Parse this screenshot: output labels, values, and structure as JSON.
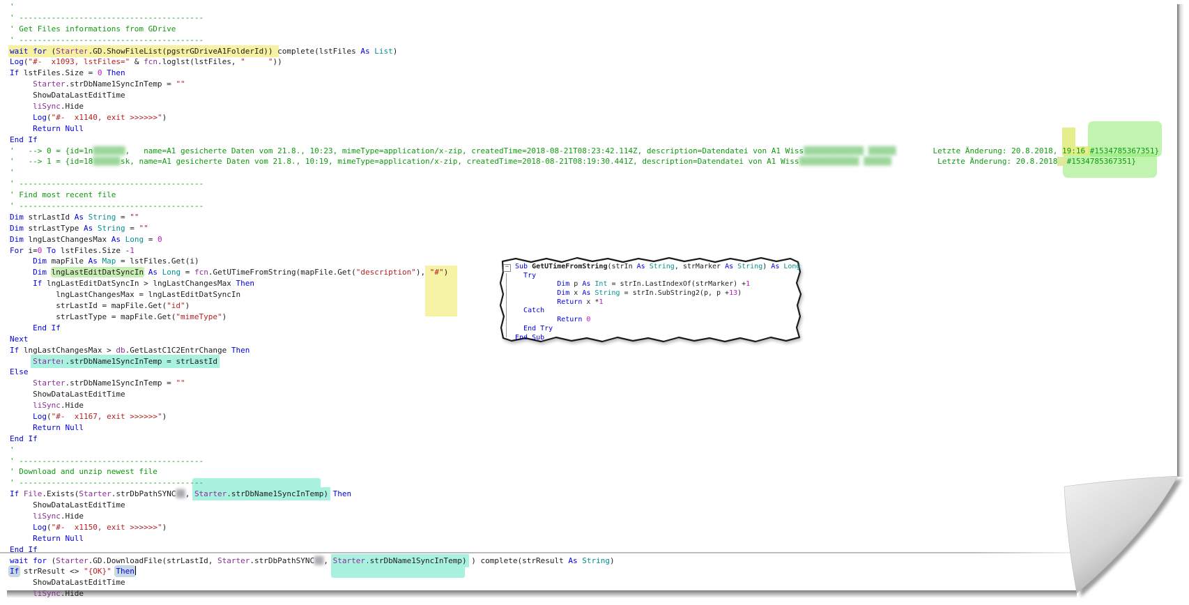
{
  "colors": {
    "keyword": "#0000E0",
    "comment": "#0D9B0D",
    "string": "#B22222",
    "number": "#C117C1",
    "module": "#8B2F97",
    "type": "#00918F",
    "plain": "#1C1C1C",
    "hl_yellow": "#F6F2A2",
    "hl_green_band": "rgba(140,235,110,0.55)",
    "hl_green_word": "#C8EEB4",
    "hl_cyan": "#A9F2E0",
    "hl_match": "#C8D8E3",
    "hl_strip": "rgba(224,235,120,0.85)"
  },
  "editor": {
    "lines": [
      {
        "segs": [
          [
            "c",
            "'"
          ]
        ]
      },
      {
        "segs": [
          [
            "c",
            "' ----------------------------------------"
          ]
        ]
      },
      {
        "segs": [
          [
            "c",
            "' Get Files informations from GDrive"
          ]
        ]
      },
      {
        "segs": [
          [
            "c",
            "' ----------------------------------------"
          ]
        ]
      },
      {
        "segs": [
          [
            "k hy",
            "wait for "
          ],
          [
            "p hy",
            "("
          ],
          [
            "m hy",
            "Starter"
          ],
          [
            "p hy",
            ".GD.ShowFileList(pgstrGDriveA1FolderId)) "
          ],
          [
            "p",
            "complete(lstFiles "
          ],
          [
            "k",
            "As "
          ],
          [
            "t",
            "List"
          ],
          [
            "p",
            ")"
          ]
        ]
      },
      {
        "segs": [
          [
            "k",
            "Log"
          ],
          [
            "p",
            "("
          ],
          [
            "s",
            "\"#-  x1093, lstFiles=\""
          ],
          [
            "p",
            " & "
          ],
          [
            "m",
            "fcn"
          ],
          [
            "p",
            ".loglst(lstFiles, "
          ],
          [
            "s",
            "\"     \""
          ],
          [
            "p",
            "))"
          ]
        ]
      },
      {
        "segs": [
          [
            "k",
            "If"
          ],
          [
            "p",
            " lstFiles.Size = "
          ],
          [
            "n",
            "0"
          ],
          [
            "p",
            " "
          ],
          [
            "k",
            "Then"
          ]
        ]
      },
      {
        "segs": [
          [
            "p",
            "     "
          ],
          [
            "m",
            "Starter"
          ],
          [
            "p",
            ".strDbName1SyncInTemp = "
          ],
          [
            "s",
            "\"\""
          ]
        ]
      },
      {
        "segs": [
          [
            "p",
            "     ShowDataLastEditTime"
          ]
        ]
      },
      {
        "segs": [
          [
            "p",
            "     "
          ],
          [
            "m",
            "liSync"
          ],
          [
            "p",
            ".Hide"
          ]
        ]
      },
      {
        "segs": [
          [
            "p",
            "     "
          ],
          [
            "k",
            "Log"
          ],
          [
            "p",
            "("
          ],
          [
            "s",
            "\"#-  x1140, exit >>>>>>\""
          ],
          [
            "p",
            ")"
          ]
        ]
      },
      {
        "segs": [
          [
            "p",
            "     "
          ],
          [
            "k",
            "Return Null"
          ]
        ]
      },
      {
        "segs": [
          [
            "k",
            "End If"
          ]
        ]
      },
      {
        "segs": [
          [
            "c",
            "'   --> 0 = {id=1n"
          ],
          [
            "rx",
            "▒▒▒▒▒▒▒"
          ],
          [
            "c",
            ",   name=A1 gesicherte Daten vom 21.8., 10:23, mimeType=application/x-zip, createdTime=2018-08-21T08:23:42.114Z, description=Datendatei von A1 Wiss"
          ],
          [
            "rx",
            "▒▒▒▒▒▒▒▒▒▒▒▒▒ ▒▒▒▒▒▒"
          ],
          [
            "c",
            "        Letzte Änderung: 20.8.2018, "
          ],
          [
            "c c13y",
            "19:16 "
          ],
          [
            "c c13g",
            "#1534785367351}"
          ]
        ]
      },
      {
        "segs": [
          [
            "c",
            "'   --> 1 = {id=18"
          ],
          [
            "rx",
            "▒▒▒▒▒▒"
          ],
          [
            "c",
            "sk, name=A1 gesicherte Daten vom 21.8., 10:19, mimeType=application/x-zip, createdTime=2018-08-21T08:19:30.441Z, description=Datendatei von A1 Wiss"
          ],
          [
            "rx",
            "▒▒▒▒▒▒▒▒▒▒▒▒▒ ▒▒▒▒▒▒"
          ],
          [
            "c",
            "          Letzte Änderung: 20.8.2018"
          ],
          [
            "c c14s",
            "  "
          ],
          [
            "c c14g",
            "#1534785367351}"
          ]
        ]
      },
      {
        "segs": [
          [
            "c",
            "'"
          ]
        ]
      },
      {
        "segs": [
          [
            "c",
            "' ----------------------------------------"
          ]
        ]
      },
      {
        "segs": [
          [
            "c",
            "' Find most recent file"
          ]
        ]
      },
      {
        "segs": [
          [
            "c",
            "' ----------------------------------------"
          ]
        ]
      },
      {
        "segs": [
          [
            "k",
            "Dim"
          ],
          [
            "p",
            " strLastId "
          ],
          [
            "k",
            "As "
          ],
          [
            "t",
            "String"
          ],
          [
            "p",
            " = "
          ],
          [
            "s",
            "\"\""
          ]
        ]
      },
      {
        "segs": [
          [
            "k",
            "Dim"
          ],
          [
            "p",
            " strLastType "
          ],
          [
            "k",
            "As "
          ],
          [
            "t",
            "String"
          ],
          [
            "p",
            " = "
          ],
          [
            "s",
            "\"\""
          ]
        ]
      },
      {
        "segs": [
          [
            "k",
            "Dim"
          ],
          [
            "p",
            " lngLastChangesMax "
          ],
          [
            "k",
            "As "
          ],
          [
            "t",
            "Long"
          ],
          [
            "p",
            " = "
          ],
          [
            "n",
            "0"
          ]
        ]
      },
      {
        "segs": [
          [
            "k",
            "For"
          ],
          [
            "p",
            " i="
          ],
          [
            "n",
            "0"
          ],
          [
            "p",
            " "
          ],
          [
            "k",
            "To"
          ],
          [
            "p",
            " lstFiles.Size -"
          ],
          [
            "n",
            "1"
          ]
        ]
      },
      {
        "segs": [
          [
            "p",
            "     "
          ],
          [
            "k",
            "Dim"
          ],
          [
            "p",
            " mapFile "
          ],
          [
            "k",
            "As "
          ],
          [
            "t",
            "Map"
          ],
          [
            "p",
            " = lstFiles.Get(i)"
          ]
        ]
      },
      {
        "segs": [
          [
            "p",
            "     "
          ],
          [
            "k",
            "Dim"
          ],
          [
            "p",
            " "
          ],
          [
            "p hgw",
            "lngLastEditDatSyncIn"
          ],
          [
            "p",
            " "
          ],
          [
            "k",
            "As "
          ],
          [
            "t",
            "Long"
          ],
          [
            "p",
            " = "
          ],
          [
            "m",
            "fcn"
          ],
          [
            "p",
            ".GetUTimeFromString(mapFile.Get("
          ],
          [
            "s",
            "\"description\""
          ],
          [
            "p",
            "), "
          ],
          [
            "s mk",
            "\"#\""
          ],
          [
            "p",
            ")"
          ]
        ]
      },
      {
        "segs": [
          [
            "p",
            "     "
          ],
          [
            "k",
            "If"
          ],
          [
            "p",
            " lngLastEditDatSyncIn > lngLastChangesMax "
          ],
          [
            "k",
            "Then"
          ]
        ]
      },
      {
        "segs": [
          [
            "p",
            "          lngLastChangesMax = lngLastEditDatSyncIn"
          ]
        ]
      },
      {
        "segs": [
          [
            "p",
            "          strLastId = mapFile.Get("
          ],
          [
            "s",
            "\"id\""
          ],
          [
            "p",
            ")"
          ]
        ]
      },
      {
        "segs": [
          [
            "p",
            "          strLastType = mapFile.Get("
          ],
          [
            "s",
            "\"mimeType\""
          ],
          [
            "p",
            ")"
          ]
        ]
      },
      {
        "segs": [
          [
            "p",
            "     "
          ],
          [
            "k",
            "End If"
          ]
        ]
      },
      {
        "segs": [
          [
            "k",
            "Next"
          ]
        ]
      },
      {
        "segs": [
          [
            "k",
            "If"
          ],
          [
            "p",
            " lngLastChangesMax > "
          ],
          [
            "m",
            "db"
          ],
          [
            "p",
            ".GetLastC1C2EntrChange "
          ],
          [
            "k",
            "Then"
          ]
        ]
      },
      {
        "segs": [
          [
            "p",
            "     "
          ],
          [
            "m hc",
            "Starter"
          ],
          [
            "p hc",
            ".strDbName1SyncInTemp = strLastId"
          ]
        ]
      },
      {
        "segs": [
          [
            "k",
            "Else"
          ]
        ]
      },
      {
        "segs": [
          [
            "p",
            "     "
          ],
          [
            "m",
            "Starter"
          ],
          [
            "p",
            ".strDbName1SyncInTemp = "
          ],
          [
            "s",
            "\"\""
          ]
        ]
      },
      {
        "segs": [
          [
            "p",
            "     ShowDataLastEditTime"
          ]
        ]
      },
      {
        "segs": [
          [
            "p",
            "     "
          ],
          [
            "m",
            "liSync"
          ],
          [
            "p",
            ".Hide"
          ]
        ]
      },
      {
        "segs": [
          [
            "p",
            "     "
          ],
          [
            "k",
            "Log"
          ],
          [
            "p",
            "("
          ],
          [
            "s",
            "\"#-  x1167, exit >>>>>>\""
          ],
          [
            "p",
            ")"
          ]
        ]
      },
      {
        "segs": [
          [
            "p",
            "     "
          ],
          [
            "k",
            "Return Null"
          ]
        ]
      },
      {
        "segs": [
          [
            "k",
            "End If"
          ]
        ]
      },
      {
        "segs": [
          [
            "c",
            "'"
          ]
        ]
      },
      {
        "segs": [
          [
            "c",
            "' ----------------------------------------"
          ]
        ]
      },
      {
        "segs": [
          [
            "c",
            "' Download and unzip newest file"
          ]
        ]
      },
      {
        "segs": [
          [
            "c",
            "' ----------------------------------------"
          ]
        ]
      },
      {
        "segs": [
          [
            "k",
            "If"
          ],
          [
            "p",
            " "
          ],
          [
            "m",
            "File"
          ],
          [
            "p",
            ".Exists("
          ],
          [
            "m",
            "Starter"
          ],
          [
            "p",
            ".strDbPathSYNC"
          ],
          [
            "rxd",
            "▒▒"
          ],
          [
            "p",
            ", "
          ],
          [
            "m hc hcu",
            "Starter"
          ],
          [
            "p hc",
            ".strDbName1SyncInTemp)"
          ],
          [
            "p",
            " "
          ],
          [
            "k",
            "Then"
          ]
        ]
      },
      {
        "segs": [
          [
            "p",
            "     ShowDataLastEditTime"
          ]
        ]
      },
      {
        "segs": [
          [
            "p",
            "     "
          ],
          [
            "m",
            "liSync"
          ],
          [
            "p",
            ".Hide"
          ]
        ]
      },
      {
        "segs": [
          [
            "p",
            "     "
          ],
          [
            "k",
            "Log"
          ],
          [
            "p",
            "("
          ],
          [
            "s",
            "\"#-  x1150, exit >>>>>>\""
          ],
          [
            "p",
            ")"
          ]
        ]
      },
      {
        "segs": [
          [
            "p",
            "     "
          ],
          [
            "k",
            "Return Null"
          ]
        ]
      },
      {
        "segs": [
          [
            "k",
            "End If"
          ]
        ]
      },
      {
        "segs": [
          [
            "k",
            "wait for"
          ],
          [
            "p",
            " ("
          ],
          [
            "m",
            "Starter"
          ],
          [
            "p",
            ".GD.DownloadFile(strLastId, "
          ],
          [
            "m",
            "Starter"
          ],
          [
            "p",
            ".strDbPathSYNC"
          ],
          [
            "rxd",
            "▒▒"
          ],
          [
            "p",
            ", "
          ],
          [
            "m hc hcd",
            "Starter"
          ],
          [
            "p hc",
            ".strDbName1SyncInTemp)"
          ],
          [
            "p",
            " ) complete(strResult "
          ],
          [
            "k",
            "As "
          ],
          [
            "t",
            "String"
          ],
          [
            "p",
            ")"
          ]
        ]
      },
      {
        "segs": [
          [
            "k hm",
            "If"
          ],
          [
            "p",
            " strResult <> "
          ],
          [
            "s",
            "\"{OK}\""
          ],
          [
            "p",
            " "
          ],
          [
            "k hm",
            "Then"
          ],
          [
            "caret",
            ""
          ]
        ]
      },
      {
        "segs": [
          [
            "p",
            "     ShowDataLastEditTime"
          ]
        ]
      },
      {
        "segs": [
          [
            "p",
            "     "
          ],
          [
            "m",
            "liSync"
          ],
          [
            "p",
            ".Hide"
          ]
        ]
      }
    ]
  },
  "popup": {
    "fold_icon": "−",
    "lines": [
      {
        "segs": [
          [
            "k",
            "Sub "
          ],
          [
            "pb",
            "GetUTimeFromString"
          ],
          [
            "p",
            "(strIn "
          ],
          [
            "k",
            "As "
          ],
          [
            "t",
            "String"
          ],
          [
            "p",
            ", strMarker "
          ],
          [
            "k",
            "As "
          ],
          [
            "t",
            "String"
          ],
          [
            "p",
            ") "
          ],
          [
            "k",
            "As "
          ],
          [
            "t",
            "Long"
          ]
        ]
      },
      {
        "segs": [
          [
            "p",
            "  "
          ],
          [
            "k",
            "Try"
          ]
        ]
      },
      {
        "segs": [
          [
            "p",
            "          "
          ],
          [
            "k",
            "Dim"
          ],
          [
            "p",
            " p "
          ],
          [
            "k",
            "As "
          ],
          [
            "t",
            "Int"
          ],
          [
            "p",
            " = strIn.LastIndexOf(strMarker) +"
          ],
          [
            "n",
            "1"
          ]
        ]
      },
      {
        "segs": [
          [
            "p",
            "          "
          ],
          [
            "k",
            "Dim"
          ],
          [
            "p",
            " x "
          ],
          [
            "k",
            "As "
          ],
          [
            "t",
            "String"
          ],
          [
            "p",
            " = strIn.SubString2(p, p +"
          ],
          [
            "n",
            "13"
          ],
          [
            "p",
            ")"
          ]
        ]
      },
      {
        "segs": [
          [
            "p",
            "          "
          ],
          [
            "k",
            "Return"
          ],
          [
            "p",
            " x *"
          ],
          [
            "n",
            "1"
          ]
        ]
      },
      {
        "segs": [
          [
            "p",
            "  "
          ],
          [
            "k",
            "Catch"
          ]
        ]
      },
      {
        "segs": [
          [
            "p",
            "          "
          ],
          [
            "k",
            "Return "
          ],
          [
            "n",
            "0"
          ]
        ]
      },
      {
        "segs": [
          [
            "p",
            "  "
          ],
          [
            "k",
            "End Try"
          ]
        ]
      },
      {
        "segs": [
          [
            "k",
            "End Sub"
          ]
        ]
      }
    ]
  }
}
